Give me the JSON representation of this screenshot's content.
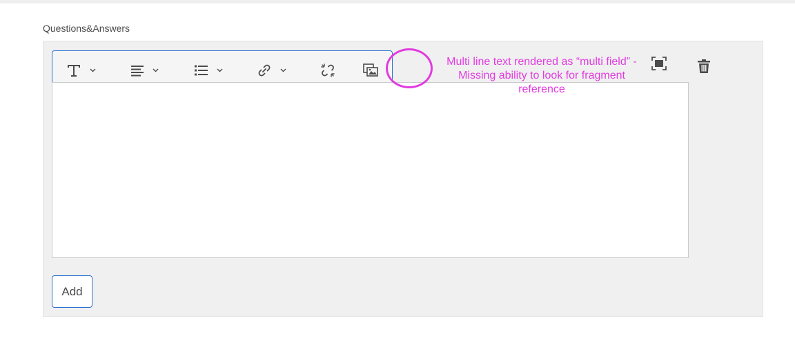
{
  "section": {
    "label": "Questions&Answers"
  },
  "toolbar": {
    "tools": [
      {
        "name": "text-format",
        "icon": "text-format-icon",
        "has_dropdown": true
      },
      {
        "name": "paragraph-align",
        "icon": "align-left-icon",
        "has_dropdown": true
      },
      {
        "name": "list",
        "icon": "bulleted-list-icon",
        "has_dropdown": true
      },
      {
        "name": "link",
        "icon": "link-icon",
        "has_dropdown": true
      },
      {
        "name": "unlink",
        "icon": "unlink-icon",
        "has_dropdown": false
      },
      {
        "name": "insert-asset",
        "icon": "image-asset-icon",
        "has_dropdown": false
      }
    ]
  },
  "editor": {
    "value": ""
  },
  "item_actions": {
    "fullscreen_icon": "fullscreen-icon",
    "delete_icon": "trash-icon"
  },
  "add_button": {
    "label": "Add"
  },
  "annotation": {
    "text": "Multi line text rendered as “multi field” - Missing ability to look for fragment reference",
    "color": "#e23be0"
  },
  "colors": {
    "accent": "#2b6fd1",
    "panel_bg": "#f0f0f0",
    "icon": "#4b4b4b"
  }
}
